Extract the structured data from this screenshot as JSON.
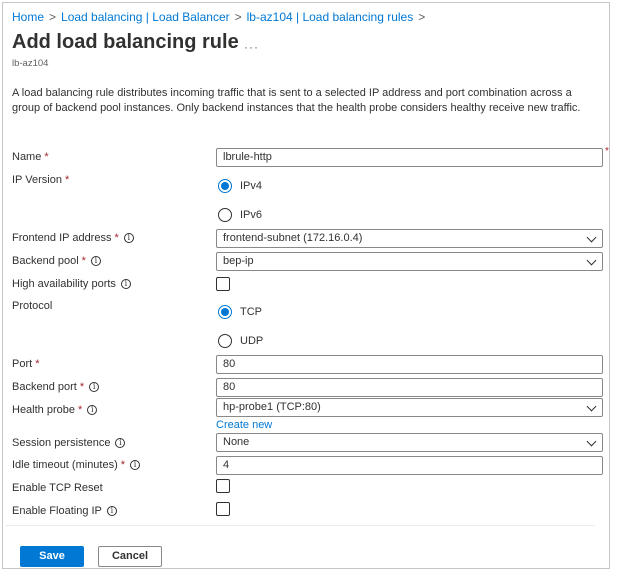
{
  "breadcrumb": {
    "items": [
      "Home",
      "Load balancing | Load Balancer",
      "lb-az104 | Load balancing rules"
    ],
    "separator": ">"
  },
  "header": {
    "title": "Add load balancing rule",
    "more": "···",
    "subtitle": "lb-az104"
  },
  "description": "A load balancing rule distributes incoming traffic that is sent to a selected IP address and port combination across a group of backend pool instances. Only backend instances that the health probe considers healthy receive new traffic.",
  "form": {
    "name": {
      "label": "Name",
      "required": "*",
      "value": "lbrule-http"
    },
    "ip_version": {
      "label": "IP Version",
      "required": "*",
      "options": [
        "IPv4",
        "IPv6"
      ],
      "selected": "IPv4"
    },
    "frontend_ip": {
      "label": "Frontend IP address",
      "required": "*",
      "value": "frontend-subnet (172.16.0.4)"
    },
    "backend_pool": {
      "label": "Backend pool",
      "required": "*",
      "value": "bep-ip"
    },
    "ha_ports": {
      "label": "High availability ports",
      "checked": false
    },
    "protocol": {
      "label": "Protocol",
      "options": [
        "TCP",
        "UDP"
      ],
      "selected": "TCP"
    },
    "port": {
      "label": "Port",
      "required": "*",
      "value": "80"
    },
    "backend_port": {
      "label": "Backend port",
      "required": "*",
      "value": "80"
    },
    "health_probe": {
      "label": "Health probe",
      "required": "*",
      "value": "hp-probe1 (TCP:80)",
      "create_new": "Create new"
    },
    "session_persistence": {
      "label": "Session persistence",
      "value": "None"
    },
    "idle_timeout": {
      "label": "Idle timeout (minutes)",
      "required": "*",
      "value": "4"
    },
    "tcp_reset": {
      "label": "Enable TCP Reset",
      "checked": false
    },
    "floating_ip": {
      "label": "Enable Floating IP",
      "checked": false
    }
  },
  "info_glyph": "i",
  "footer": {
    "save_label": "Save",
    "cancel_label": "Cancel"
  },
  "colors": {
    "accent": "#0078d4",
    "required": "#a4262c",
    "text": "#323130"
  }
}
